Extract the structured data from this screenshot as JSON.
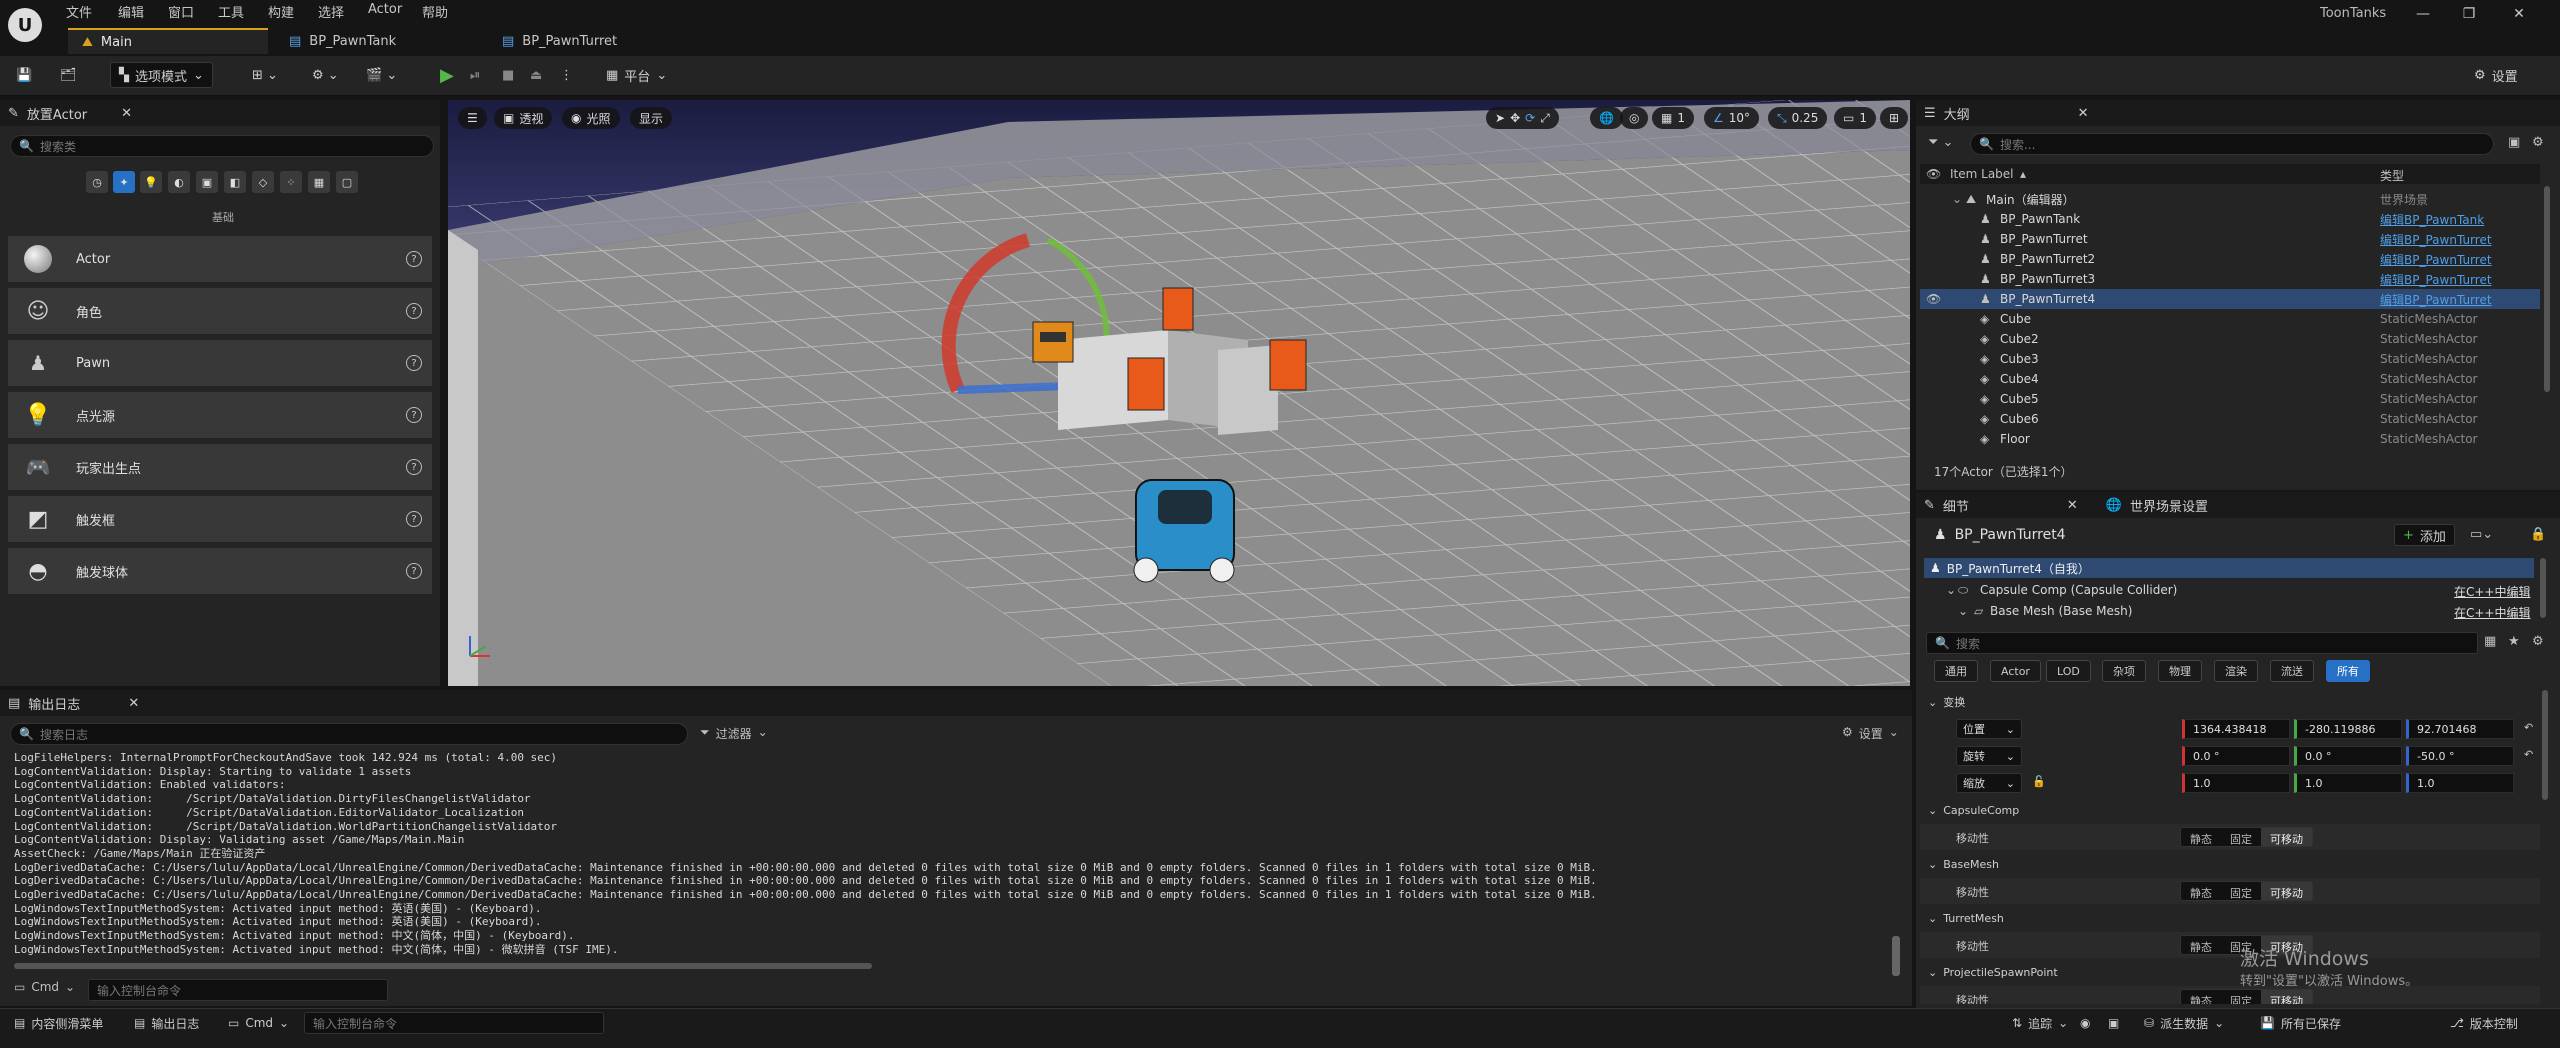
{
  "app": {
    "title": "ToonTanks",
    "menus": [
      "文件",
      "编辑",
      "窗口",
      "工具",
      "构建",
      "选择",
      "Actor",
      "帮助"
    ]
  },
  "tabs": [
    {
      "label": "Main"
    },
    {
      "label": "BP_PawnTank"
    },
    {
      "label": "BP_PawnTurret"
    }
  ],
  "toolbar": {
    "mode": "选项模式",
    "platform": "平台",
    "settings": "设置"
  },
  "place_actors": {
    "title": "放置Actor",
    "search_placeholder": "搜索类",
    "category": "基础",
    "items": [
      {
        "label": "Actor"
      },
      {
        "label": "角色"
      },
      {
        "label": "Pawn"
      },
      {
        "label": "点光源"
      },
      {
        "label": "玩家出生点"
      },
      {
        "label": "触发框"
      },
      {
        "label": "触发球体"
      }
    ]
  },
  "viewport": {
    "perspective": "透视",
    "lighting": "光照",
    "show": "显示",
    "grid_count": "1",
    "angle_snap": "10°",
    "scale_snap": "0.25",
    "camera_speed": "1"
  },
  "outliner": {
    "title": "大纲",
    "search_placeholder": "搜索...",
    "col_label": "Item Label",
    "col_type": "类型",
    "root": {
      "label": "Main（编辑器）",
      "type": "世界场景"
    },
    "rows": [
      {
        "label": "BP_PawnTank",
        "type": "编辑BP_PawnTank"
      },
      {
        "label": "BP_PawnTurret",
        "type": "编辑BP_PawnTurret"
      },
      {
        "label": "BP_PawnTurret2",
        "type": "编辑BP_PawnTurret"
      },
      {
        "label": "BP_PawnTurret3",
        "type": "编辑BP_PawnTurret"
      },
      {
        "label": "BP_PawnTurret4",
        "type": "编辑BP_PawnTurret"
      },
      {
        "label": "Cube",
        "type": "StaticMeshActor"
      },
      {
        "label": "Cube2",
        "type": "StaticMeshActor"
      },
      {
        "label": "Cube3",
        "type": "StaticMeshActor"
      },
      {
        "label": "Cube4",
        "type": "StaticMeshActor"
      },
      {
        "label": "Cube5",
        "type": "StaticMeshActor"
      },
      {
        "label": "Cube6",
        "type": "StaticMeshActor"
      },
      {
        "label": "Floor",
        "type": "StaticMeshActor"
      }
    ],
    "footer": "17个Actor（已选择1个）"
  },
  "details": {
    "tab1": "细节",
    "tab2": "世界场景设置",
    "object": "BP_PawnTurret4",
    "add": "添加",
    "self_row": "BP_PawnTurret4（自我）",
    "comp1": "Capsule Comp (Capsule Collider)",
    "comp1_link": "在C++中编辑",
    "comp2": "Base Mesh (Base Mesh)",
    "comp2_link": "在C++中编辑",
    "search_placeholder": "搜索",
    "filters": [
      "通用",
      "Actor",
      "LOD",
      "杂项",
      "物理",
      "渲染",
      "流送",
      "所有"
    ],
    "transform": {
      "title": "变换",
      "location_label": "位置",
      "rotation_label": "旋转",
      "scale_label": "缩放",
      "location": [
        "1364.438418",
        "-280.119886",
        "92.701468"
      ],
      "rotation": [
        "0.0 °",
        "0.0 °",
        "-50.0 °"
      ],
      "scale": [
        "1.0",
        "1.0",
        "1.0"
      ]
    },
    "sections": [
      "CapsuleComp",
      "BaseMesh",
      "TurretMesh",
      "ProjectileSpawnPoint"
    ],
    "mobility_label": "移动性",
    "mobility_options": [
      "静态",
      "固定",
      "可移动"
    ]
  },
  "output_log": {
    "title": "输出日志",
    "search_placeholder": "搜索日志",
    "filter": "过滤器",
    "settings": "设置",
    "lines": [
      "LogFileHelpers: InternalPromptForCheckoutAndSave took 142.924 ms (total: 4.00 sec)",
      "LogContentValidation: Display: Starting to validate 1 assets",
      "LogContentValidation: Enabled validators:",
      "LogContentValidation:     /Script/DataValidation.DirtyFilesChangelistValidator",
      "LogContentValidation:     /Script/DataValidation.EditorValidator_Localization",
      "LogContentValidation:     /Script/DataValidation.WorldPartitionChangelistValidator",
      "LogContentValidation: Display: Validating asset /Game/Maps/Main.Main",
      "AssetCheck: /Game/Maps/Main 正在验证资产",
      "LogDerivedDataCache: C:/Users/lulu/AppData/Local/UnrealEngine/Common/DerivedDataCache: Maintenance finished in +00:00:00.000 and deleted 0 files with total size 0 MiB and 0 empty folders. Scanned 0 files in 1 folders with total size 0 MiB.",
      "LogDerivedDataCache: C:/Users/lulu/AppData/Local/UnrealEngine/Common/DerivedDataCache: Maintenance finished in +00:00:00.000 and deleted 0 files with total size 0 MiB and 0 empty folders. Scanned 0 files in 1 folders with total size 0 MiB.",
      "LogDerivedDataCache: C:/Users/lulu/AppData/Local/UnrealEngine/Common/DerivedDataCache: Maintenance finished in +00:00:00.000 and deleted 0 files with total size 0 MiB and 0 empty folders. Scanned 0 files in 1 folders with total size 0 MiB.",
      "LogWindowsTextInputMethodSystem: Activated input method: 英语(美国) - (Keyboard).",
      "LogWindowsTextInputMethodSystem: Activated input method: 英语(美国) - (Keyboard).",
      "LogWindowsTextInputMethodSystem: Activated input method: 中文(简体，中国) - (Keyboard).",
      "LogWindowsTextInputMethodSystem: Activated input method: 中文(简体，中国) - 微软拼音 (TSF IME)."
    ],
    "cmd": "Cmd",
    "cmd_placeholder": "输入控制台命令"
  },
  "statusbar": {
    "content_drawer": "内容侧滑菜单",
    "output_log": "输出日志",
    "cmd": "Cmd",
    "cmd_placeholder": "输入控制台命令",
    "trace": "追踪",
    "derived_data": "派生数据",
    "all_saved": "所有已保存",
    "source_control": "版本控制"
  },
  "watermark": {
    "line1": "激活 Windows",
    "line2": "转到\"设置\"以激活 Windows。"
  },
  "colors": {
    "accent": "#2670c6",
    "tab_accent": "#d8a21e",
    "play": "#54b848",
    "link": "#4f9ee8"
  }
}
